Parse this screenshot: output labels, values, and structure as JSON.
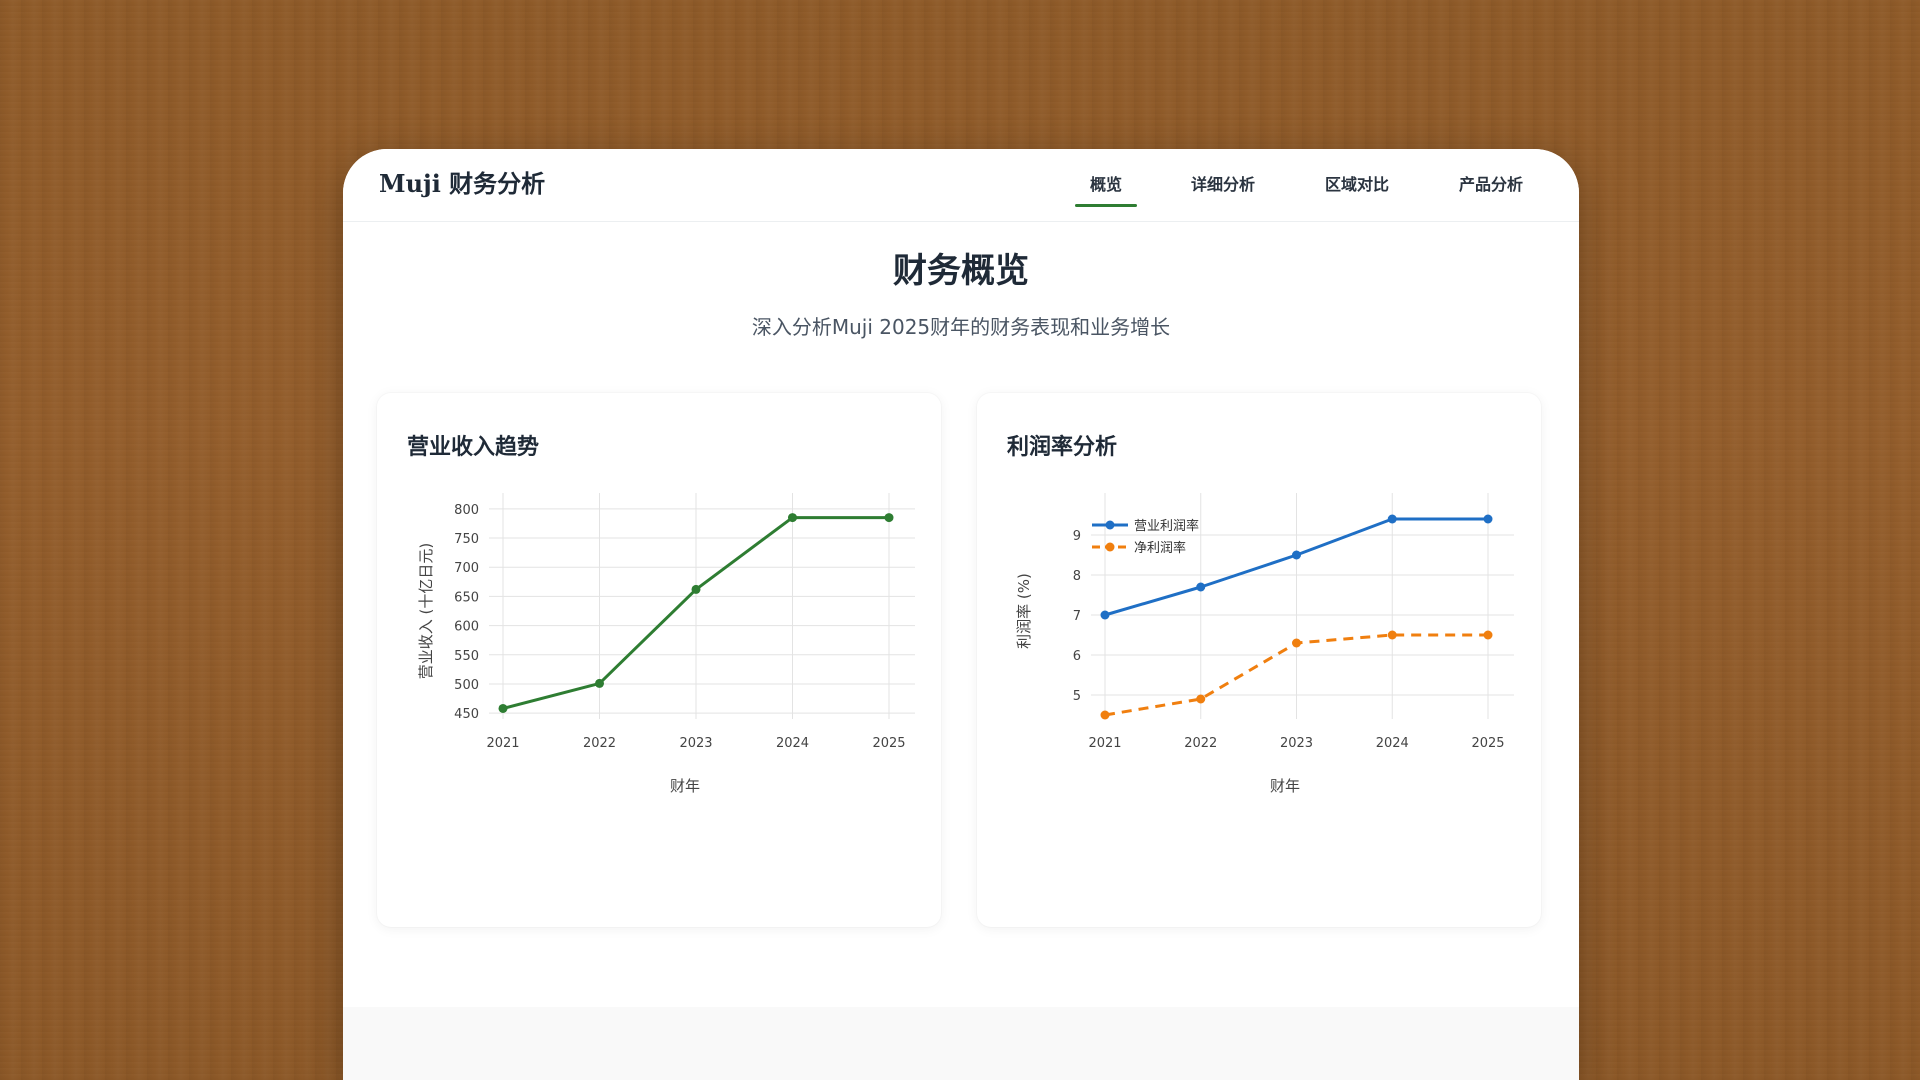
{
  "app": {
    "brand": "Muji 财务分析",
    "nav": [
      {
        "label": "概览",
        "active": true
      },
      {
        "label": "详细分析",
        "active": false
      },
      {
        "label": "区域对比",
        "active": false
      },
      {
        "label": "产品分析",
        "active": false
      }
    ],
    "accent_color": "#2e7d32"
  },
  "page": {
    "title": "财务概览",
    "subtitle": "深入分析Muji 2025财年的财务表现和业务增长"
  },
  "cards": [
    {
      "title": "营业收入趋势"
    },
    {
      "title": "利润率分析"
    }
  ],
  "chart_data": [
    {
      "type": "line",
      "title": "营业收入趋势",
      "x": [
        "2021",
        "2022",
        "2023",
        "2024",
        "2025"
      ],
      "series": [
        {
          "values": [
            458,
            501,
            662,
            785,
            785
          ],
          "color": "#2e7d32",
          "dash": "solid"
        }
      ],
      "xlabel": "财年",
      "ylabel": "营业收入 (十亿日元)",
      "ylim": [
        440,
        810
      ],
      "yticks": [
        450,
        500,
        550,
        600,
        650,
        700,
        750,
        800
      ],
      "grid": true,
      "legend": "none"
    },
    {
      "type": "line",
      "title": "利润率分析",
      "x": [
        "2021",
        "2022",
        "2023",
        "2024",
        "2025"
      ],
      "series": [
        {
          "name": "营业利润率",
          "values": [
            7.0,
            7.7,
            8.5,
            9.4,
            9.4
          ],
          "color": "#1f6fc5",
          "dash": "solid"
        },
        {
          "name": "净利润率",
          "values": [
            4.5,
            4.9,
            6.3,
            6.5,
            6.5
          ],
          "color": "#f07f0f",
          "dash": "dashed"
        }
      ],
      "xlabel": "财年",
      "ylabel": "利润率 (%)",
      "ylim": [
        4.4,
        9.8
      ],
      "yticks": [
        5,
        6,
        7,
        8,
        9
      ],
      "grid": true,
      "legend": "top-left"
    }
  ]
}
